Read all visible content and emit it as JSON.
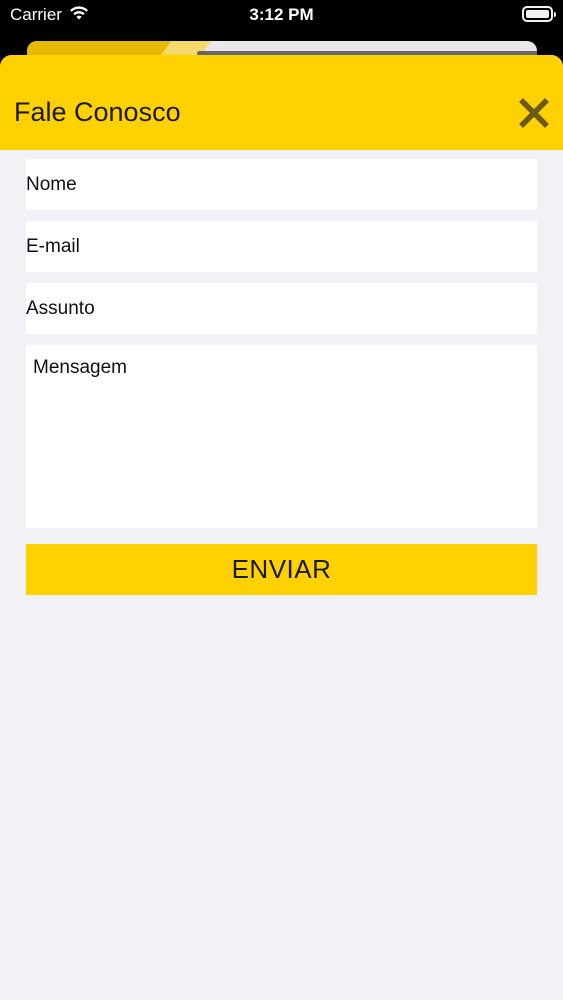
{
  "status_bar": {
    "carrier": "Carrier",
    "time": "3:12 PM",
    "wifi_icon": "wifi-icon",
    "battery_icon": "battery-icon"
  },
  "sheet": {
    "title": "Fale Conosco",
    "close_icon": "close-icon",
    "accent_color": "#ffd100"
  },
  "form": {
    "fields": [
      {
        "placeholder": "Nome"
      },
      {
        "placeholder": "E-mail"
      },
      {
        "placeholder": "Assunto"
      }
    ],
    "message_placeholder": "Mensagem",
    "submit_label": "ENVIAR"
  }
}
